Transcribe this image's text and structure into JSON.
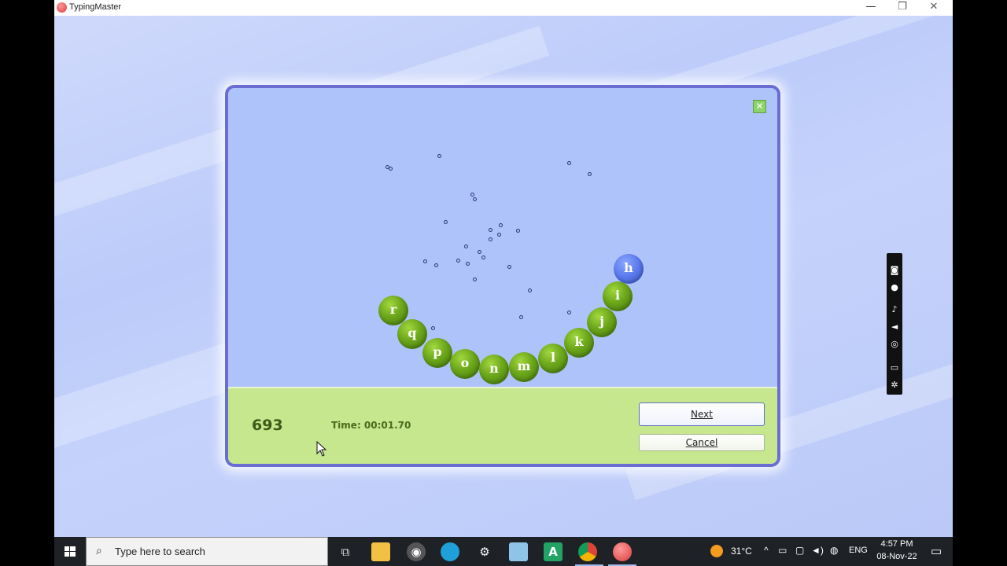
{
  "window": {
    "title": "TypingMaster",
    "minimize_glyph": "—",
    "restore_glyph": "❐",
    "close_glyph": "✕"
  },
  "game": {
    "close_glyph": "✕",
    "balls": [
      {
        "letter": "r",
        "color": "green"
      },
      {
        "letter": "q",
        "color": "green"
      },
      {
        "letter": "p",
        "color": "green"
      },
      {
        "letter": "o",
        "color": "green"
      },
      {
        "letter": "n",
        "color": "green"
      },
      {
        "letter": "m",
        "color": "green"
      },
      {
        "letter": "l",
        "color": "green"
      },
      {
        "letter": "k",
        "color": "green"
      },
      {
        "letter": "j",
        "color": "green"
      },
      {
        "letter": "i",
        "color": "green"
      },
      {
        "letter": "h",
        "color": "blue"
      }
    ]
  },
  "panel": {
    "score": "693",
    "time": "Time: 00:01.70",
    "next_label": "Next",
    "cancel_label": "Cancel"
  },
  "taskbar": {
    "search_placeholder": "Type here to search",
    "weather_temp": "31°C",
    "language": "ENG",
    "clock_time": "4:57 PM",
    "clock_date": "08-Nov-22",
    "excel_letter": "A"
  },
  "colors": {
    "dialog_border": "#6a6ed2",
    "game_bg": "#afc3fb",
    "panel_bg": "#c7e78e",
    "ball_green": "#6ba61a",
    "ball_blue": "#5b79ec"
  }
}
